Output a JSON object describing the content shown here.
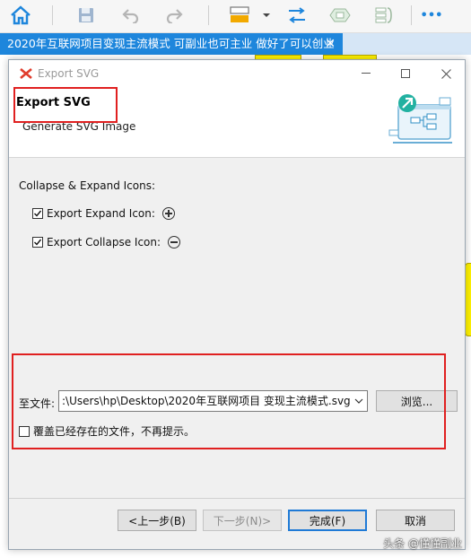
{
  "toolbar": {
    "icons": [
      "home-icon",
      "save-icon",
      "undo-icon",
      "redo-icon",
      "insert-topic-icon",
      "dropdown-arrow-icon",
      "relationship-icon",
      "boundary-icon",
      "summary-icon",
      "more-icon"
    ],
    "more": "•••"
  },
  "document_tab": {
    "title": "2020年互联网项目变现主流模式 可副业也可主业 做好了可以创业",
    "close": "✕"
  },
  "dialog": {
    "window_title": "Export SVG",
    "header_title": "Export SVG",
    "header_subtitle": "Generate SVG Image",
    "section_label": "Collapse & Expand Icons:",
    "options": [
      {
        "label": "Export Expand Icon:",
        "checked": true,
        "icon": "plus-circle-icon"
      },
      {
        "label": "Export Collapse Icon:",
        "checked": true,
        "icon": "minus-circle-icon"
      }
    ],
    "file_label": "至文件:",
    "file_path": ":\\Users\\hp\\Desktop\\2020年互联网项目 变现主流模式.svg",
    "browse_label": "浏览...",
    "overwrite_label": "覆盖已经存在的文件，不再提示。",
    "overwrite_checked": false,
    "buttons": {
      "back": "<上一步(B)",
      "next": "下一步(N)>",
      "finish": "完成(F)",
      "cancel": "取消"
    }
  },
  "watermark": "头条 @懂懂副业",
  "colors": {
    "accent": "#1e86dc",
    "highlight": "#e02020"
  }
}
